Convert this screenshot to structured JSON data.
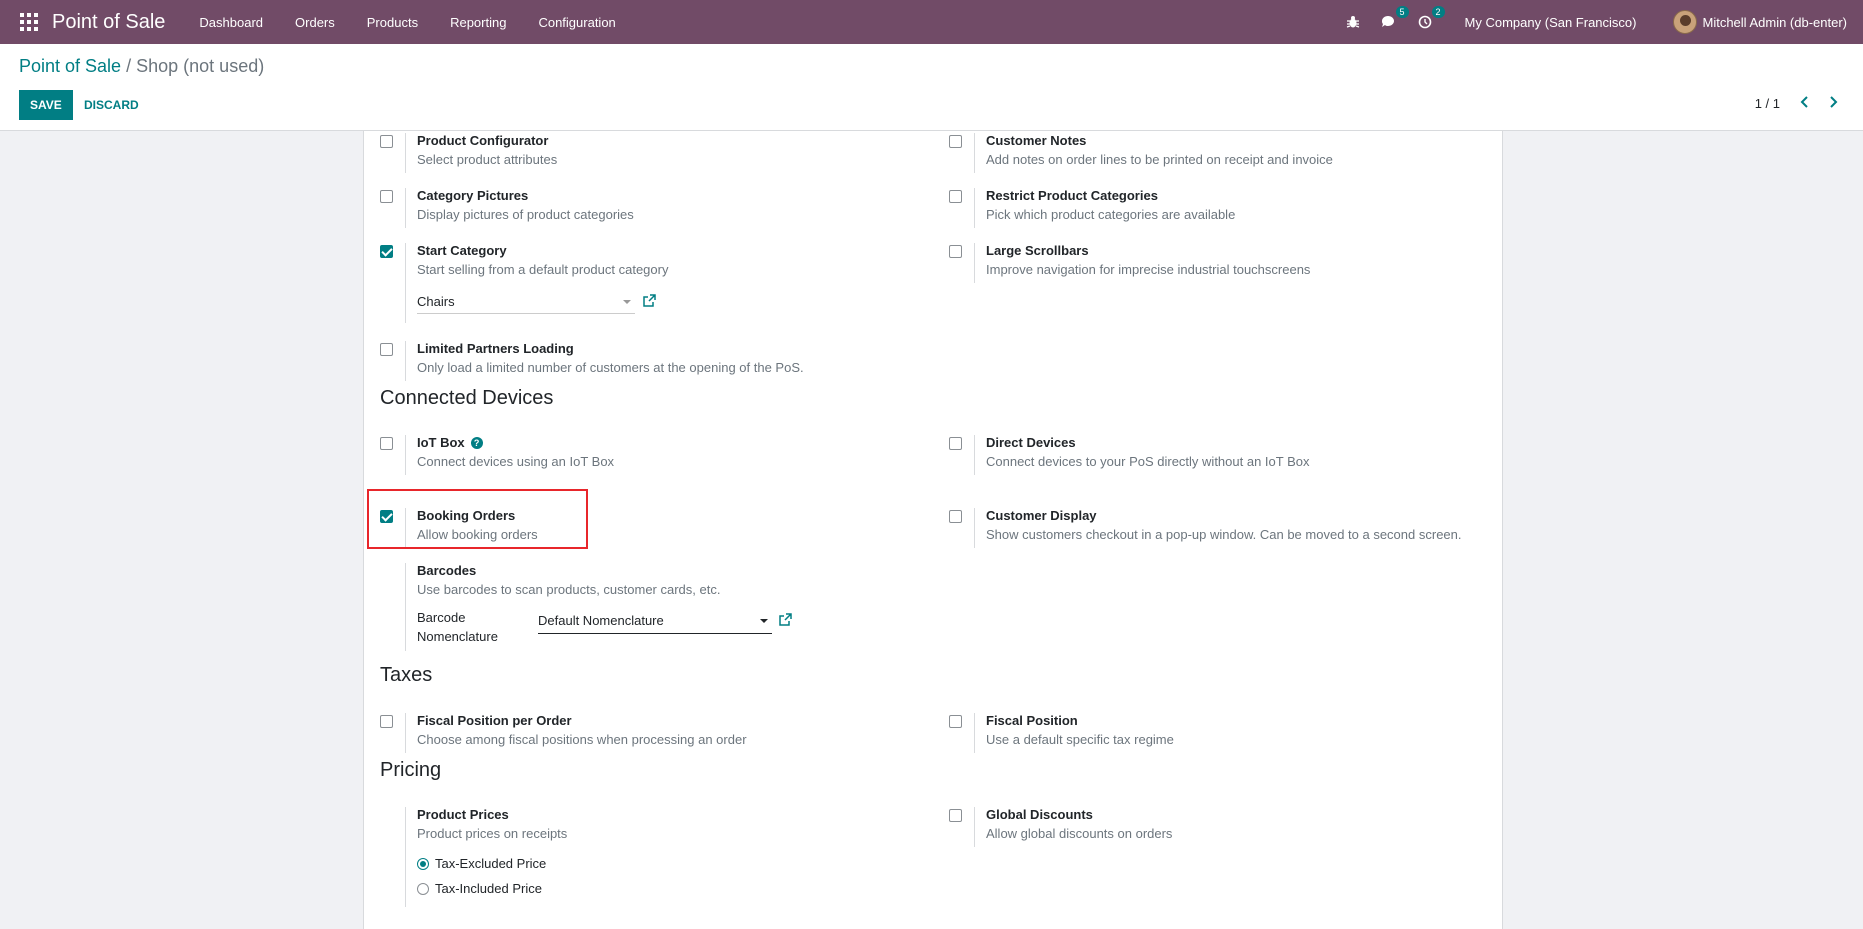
{
  "navbar": {
    "app_name": "Point of Sale",
    "menu": [
      "Dashboard",
      "Orders",
      "Products",
      "Reporting",
      "Configuration"
    ],
    "messages_count": "5",
    "activities_count": "2",
    "company": "My Company (San Francisco)",
    "user": "Mitchell Admin (db-enter)"
  },
  "control": {
    "breadcrumb_parent": "Point of Sale",
    "breadcrumb_sep": "/",
    "breadcrumb_current": "Shop (not used)",
    "save_label": "SAVE",
    "discard_label": "DISCARD",
    "pager": "1 / 1"
  },
  "settings": {
    "product_configurator": {
      "title": "Product Configurator",
      "desc": "Select product attributes"
    },
    "customer_notes": {
      "title": "Customer Notes",
      "desc": "Add notes on order lines to be printed on receipt and invoice"
    },
    "category_pictures": {
      "title": "Category Pictures",
      "desc": "Display pictures of product categories"
    },
    "restrict_categories": {
      "title": "Restrict Product Categories",
      "desc": "Pick which product categories are available"
    },
    "start_category": {
      "title": "Start Category",
      "desc": "Start selling from a default product category",
      "value": "Chairs"
    },
    "large_scrollbars": {
      "title": "Large Scrollbars",
      "desc": "Improve navigation for imprecise industrial touchscreens"
    },
    "limited_partners": {
      "title": "Limited Partners Loading",
      "desc": "Only load a limited number of customers at the opening of the PoS."
    },
    "iot_box": {
      "title": "IoT Box",
      "desc": "Connect devices using an IoT Box"
    },
    "direct_devices": {
      "title": "Direct Devices",
      "desc": "Connect devices to your PoS directly without an IoT Box"
    },
    "booking_orders": {
      "title": "Booking Orders",
      "desc": "Allow booking orders"
    },
    "customer_display": {
      "title": "Customer Display",
      "desc": "Show customers checkout in a pop-up window. Can be moved to a second screen."
    },
    "barcodes": {
      "title": "Barcodes",
      "desc": "Use barcodes to scan products, customer cards, etc.",
      "label_line1": "Barcode",
      "label_line2": "Nomenclature",
      "value": "Default Nomenclature"
    },
    "fiscal_position_order": {
      "title": "Fiscal Position per Order",
      "desc": "Choose among fiscal positions when processing an order"
    },
    "fiscal_position": {
      "title": "Fiscal Position",
      "desc": "Use a default specific tax regime"
    },
    "product_prices": {
      "title": "Product Prices",
      "desc": "Product prices on receipts",
      "option_excluded": "Tax-Excluded Price",
      "option_included": "Tax-Included Price"
    },
    "global_discounts": {
      "title": "Global Discounts",
      "desc": "Allow global discounts on orders"
    }
  },
  "sections": {
    "connected_devices": "Connected Devices",
    "taxes": "Taxes",
    "pricing": "Pricing"
  },
  "colors": {
    "navbar": "#714b67",
    "accent": "#017e84",
    "highlight": "#e8262b"
  }
}
